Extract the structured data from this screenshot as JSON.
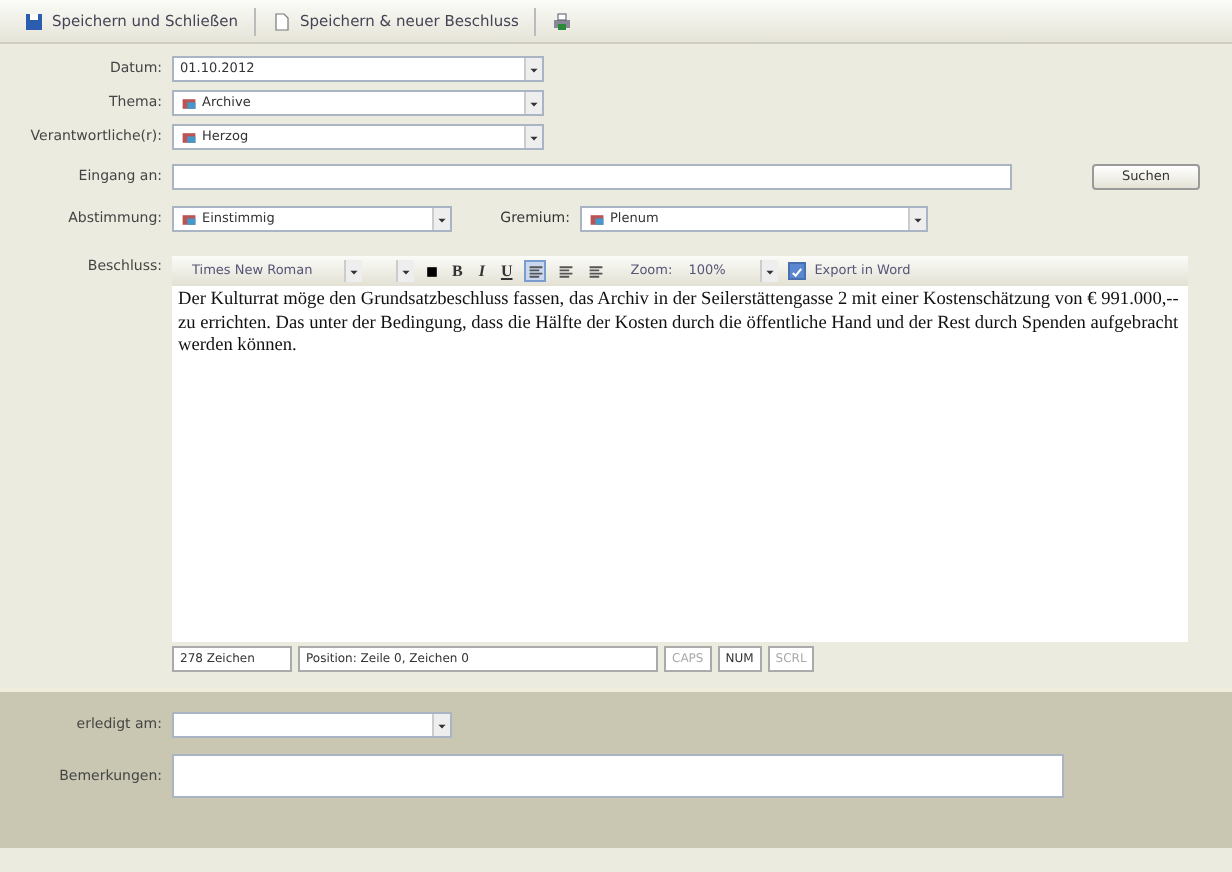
{
  "toolbar": [
    {
      "kind": "save",
      "label": "Speichern und Schließen"
    },
    {
      "kind": "new",
      "label": "Speichern & neuer Beschluss"
    },
    {
      "kind": "print"
    }
  ],
  "fields": [
    {
      "label": "Datum:",
      "kind": "combo",
      "value": "01.10.2012"
    },
    {
      "label": "Thema:",
      "kind": "combo",
      "value": "Archive",
      "icon": true
    },
    {
      "label": "Verantwortliche(r):",
      "kind": "combo",
      "value": "Herzog",
      "icon": true
    },
    {
      "label": "Eingang an:",
      "kind": "search",
      "button": "Suchen"
    }
  ],
  "vote": {
    "label": "Abstimmung:",
    "value": "Einstimmig",
    "gremium_label": "Gremium:",
    "gremium_value": "Plenum"
  },
  "editor": {
    "label": "Beschluss:",
    "font": "Times New Roman",
    "format": [
      "B",
      "I",
      "U"
    ],
    "align": [
      {
        "selected": true
      },
      {
        "selected": false
      },
      {
        "selected": false
      }
    ],
    "zoom_label": "Zoom:",
    "zoom": "100%",
    "export": {
      "label": "Export in Word",
      "checked": true
    },
    "text": "Der Kulturrat möge den Grundsatzbeschluss fassen, das Archiv in der Seilerstättengasse 2 mit einer Kostenschätzung von € 991.000,-- zu errichten. Das unter der Bedingung, dass die Hälfte der Kosten durch die öffentliche Hand und der Rest durch Spenden aufgebracht werden können.",
    "status": [
      {
        "text": "278 Zeichen",
        "disabled": false
      },
      {
        "text": "Position: Zeile 0, Zeichen 0",
        "disabled": false
      },
      {
        "text": "CAPS",
        "disabled": true
      },
      {
        "text": "NUM",
        "disabled": false
      },
      {
        "text": "SCRL",
        "disabled": true
      }
    ]
  },
  "bottom": [
    {
      "label": "erledigt am:",
      "kind": "combo"
    },
    {
      "label": "Bemerkungen:",
      "kind": "text"
    }
  ]
}
